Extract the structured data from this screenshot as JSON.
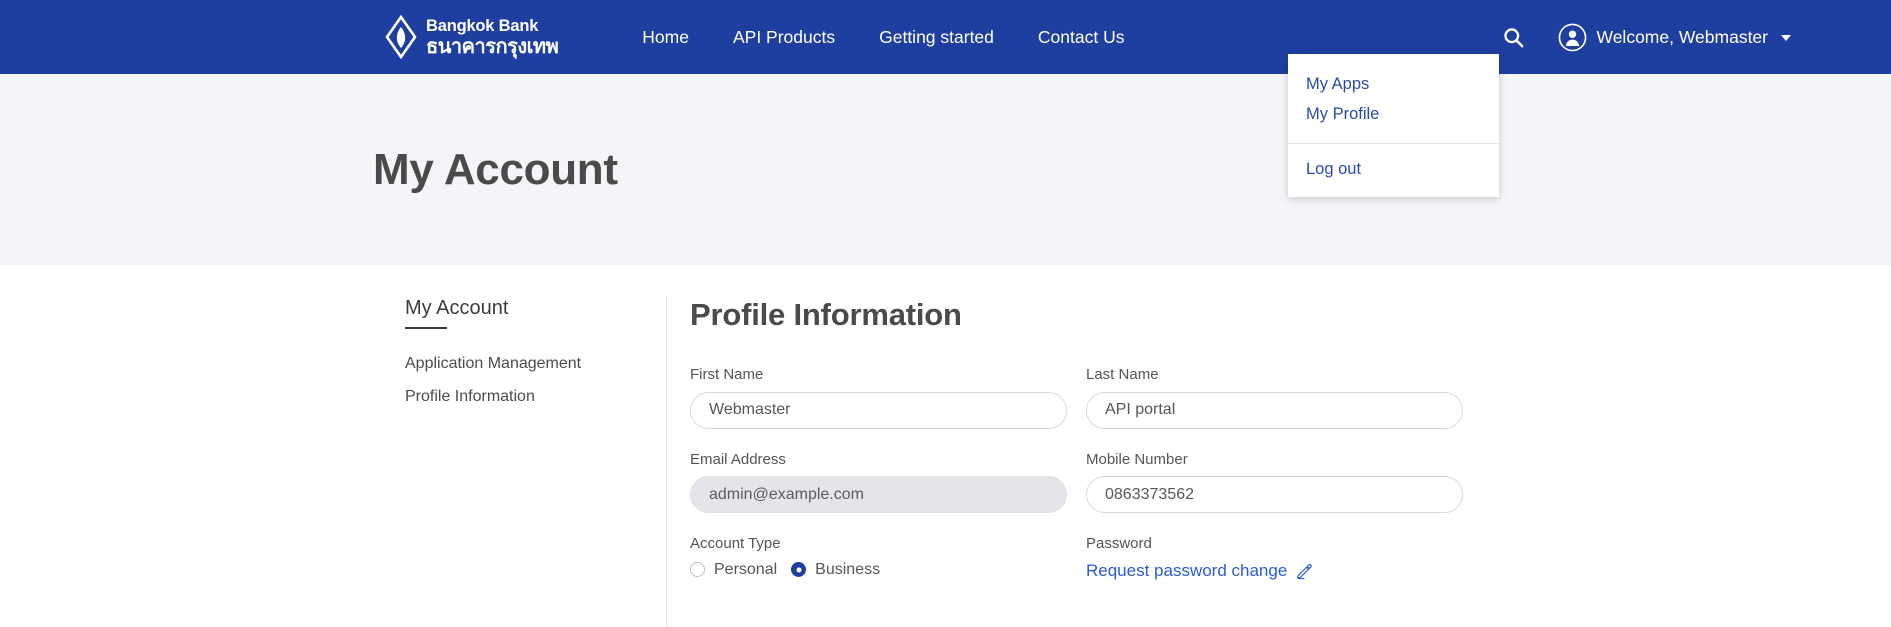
{
  "header": {
    "brand": {
      "name_en": "Bangkok Bank",
      "name_th": "ธนาคารกรุงเทพ",
      "logo_icon": "diamond-leaf-logo-icon"
    },
    "nav": [
      {
        "label": "Home",
        "name": "nav-home"
      },
      {
        "label": "API Products",
        "name": "nav-api-products"
      },
      {
        "label": "Getting started",
        "name": "nav-getting-started"
      },
      {
        "label": "Contact Us",
        "name": "nav-contact-us"
      }
    ],
    "search_icon": "search-icon",
    "user": {
      "avatar_icon": "user-avatar-icon",
      "greeting": "Welcome, Webmaster",
      "caret_icon": "caret-down-icon"
    },
    "background_color": "#1f3fa0"
  },
  "user_dropdown": {
    "visible": true,
    "primary_items": [
      {
        "label": "My Apps",
        "name": "dropdown-my-apps"
      },
      {
        "label": "My Profile",
        "name": "dropdown-my-profile"
      }
    ],
    "secondary_items": [
      {
        "label": "Log out",
        "name": "dropdown-log-out"
      }
    ],
    "link_color": "#2a4bad"
  },
  "hero": {
    "title": "My Account",
    "background_color": "#f4f5f9"
  },
  "sidebar": {
    "title": "My Account",
    "links": [
      {
        "label": "Application Management",
        "name": "sidebar-item-application-management"
      },
      {
        "label": "Profile Information",
        "name": "sidebar-item-profile-information"
      }
    ]
  },
  "profile": {
    "panel_title": "Profile Information",
    "fields": {
      "first_name": {
        "label": "First Name",
        "value": "Webmaster",
        "disabled": false
      },
      "last_name": {
        "label": "Last Name",
        "value": "API portal",
        "disabled": false
      },
      "email": {
        "label": "Email Address",
        "value": "admin@example.com",
        "disabled": true
      },
      "mobile": {
        "label": "Mobile Number",
        "value": "0863373562",
        "disabled": false
      }
    },
    "account_type": {
      "label": "Account Type",
      "options": [
        {
          "label": "Personal",
          "selected": false
        },
        {
          "label": "Business",
          "selected": true
        }
      ],
      "selected_color": "#1f3fa0"
    },
    "password": {
      "label": "Password",
      "link_label": "Request password change",
      "edit_icon": "pencil-edit-icon",
      "link_color": "#2a5bd7"
    }
  }
}
